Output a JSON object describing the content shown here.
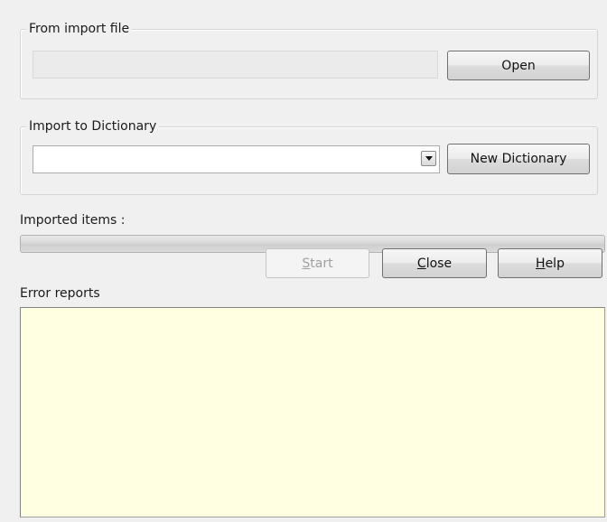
{
  "import_file": {
    "legend": "From import file",
    "path_value": "",
    "open_label": "Open"
  },
  "import_dictionary": {
    "legend": "Import to Dictionary",
    "selected": "",
    "new_dictionary_label": "New Dictionary"
  },
  "progress": {
    "label": "Imported items :",
    "value": 0
  },
  "actions": {
    "start": {
      "pre": "",
      "mnemonic": "S",
      "post": "tart"
    },
    "close": {
      "pre": "",
      "mnemonic": "C",
      "post": "lose"
    },
    "help": {
      "pre": "",
      "mnemonic": "H",
      "post": "elp"
    }
  },
  "errors": {
    "label": "Error reports",
    "text": ""
  },
  "colors": {
    "dialog_bg": "#f0f0f0",
    "error_bg": "#ffffe1"
  }
}
